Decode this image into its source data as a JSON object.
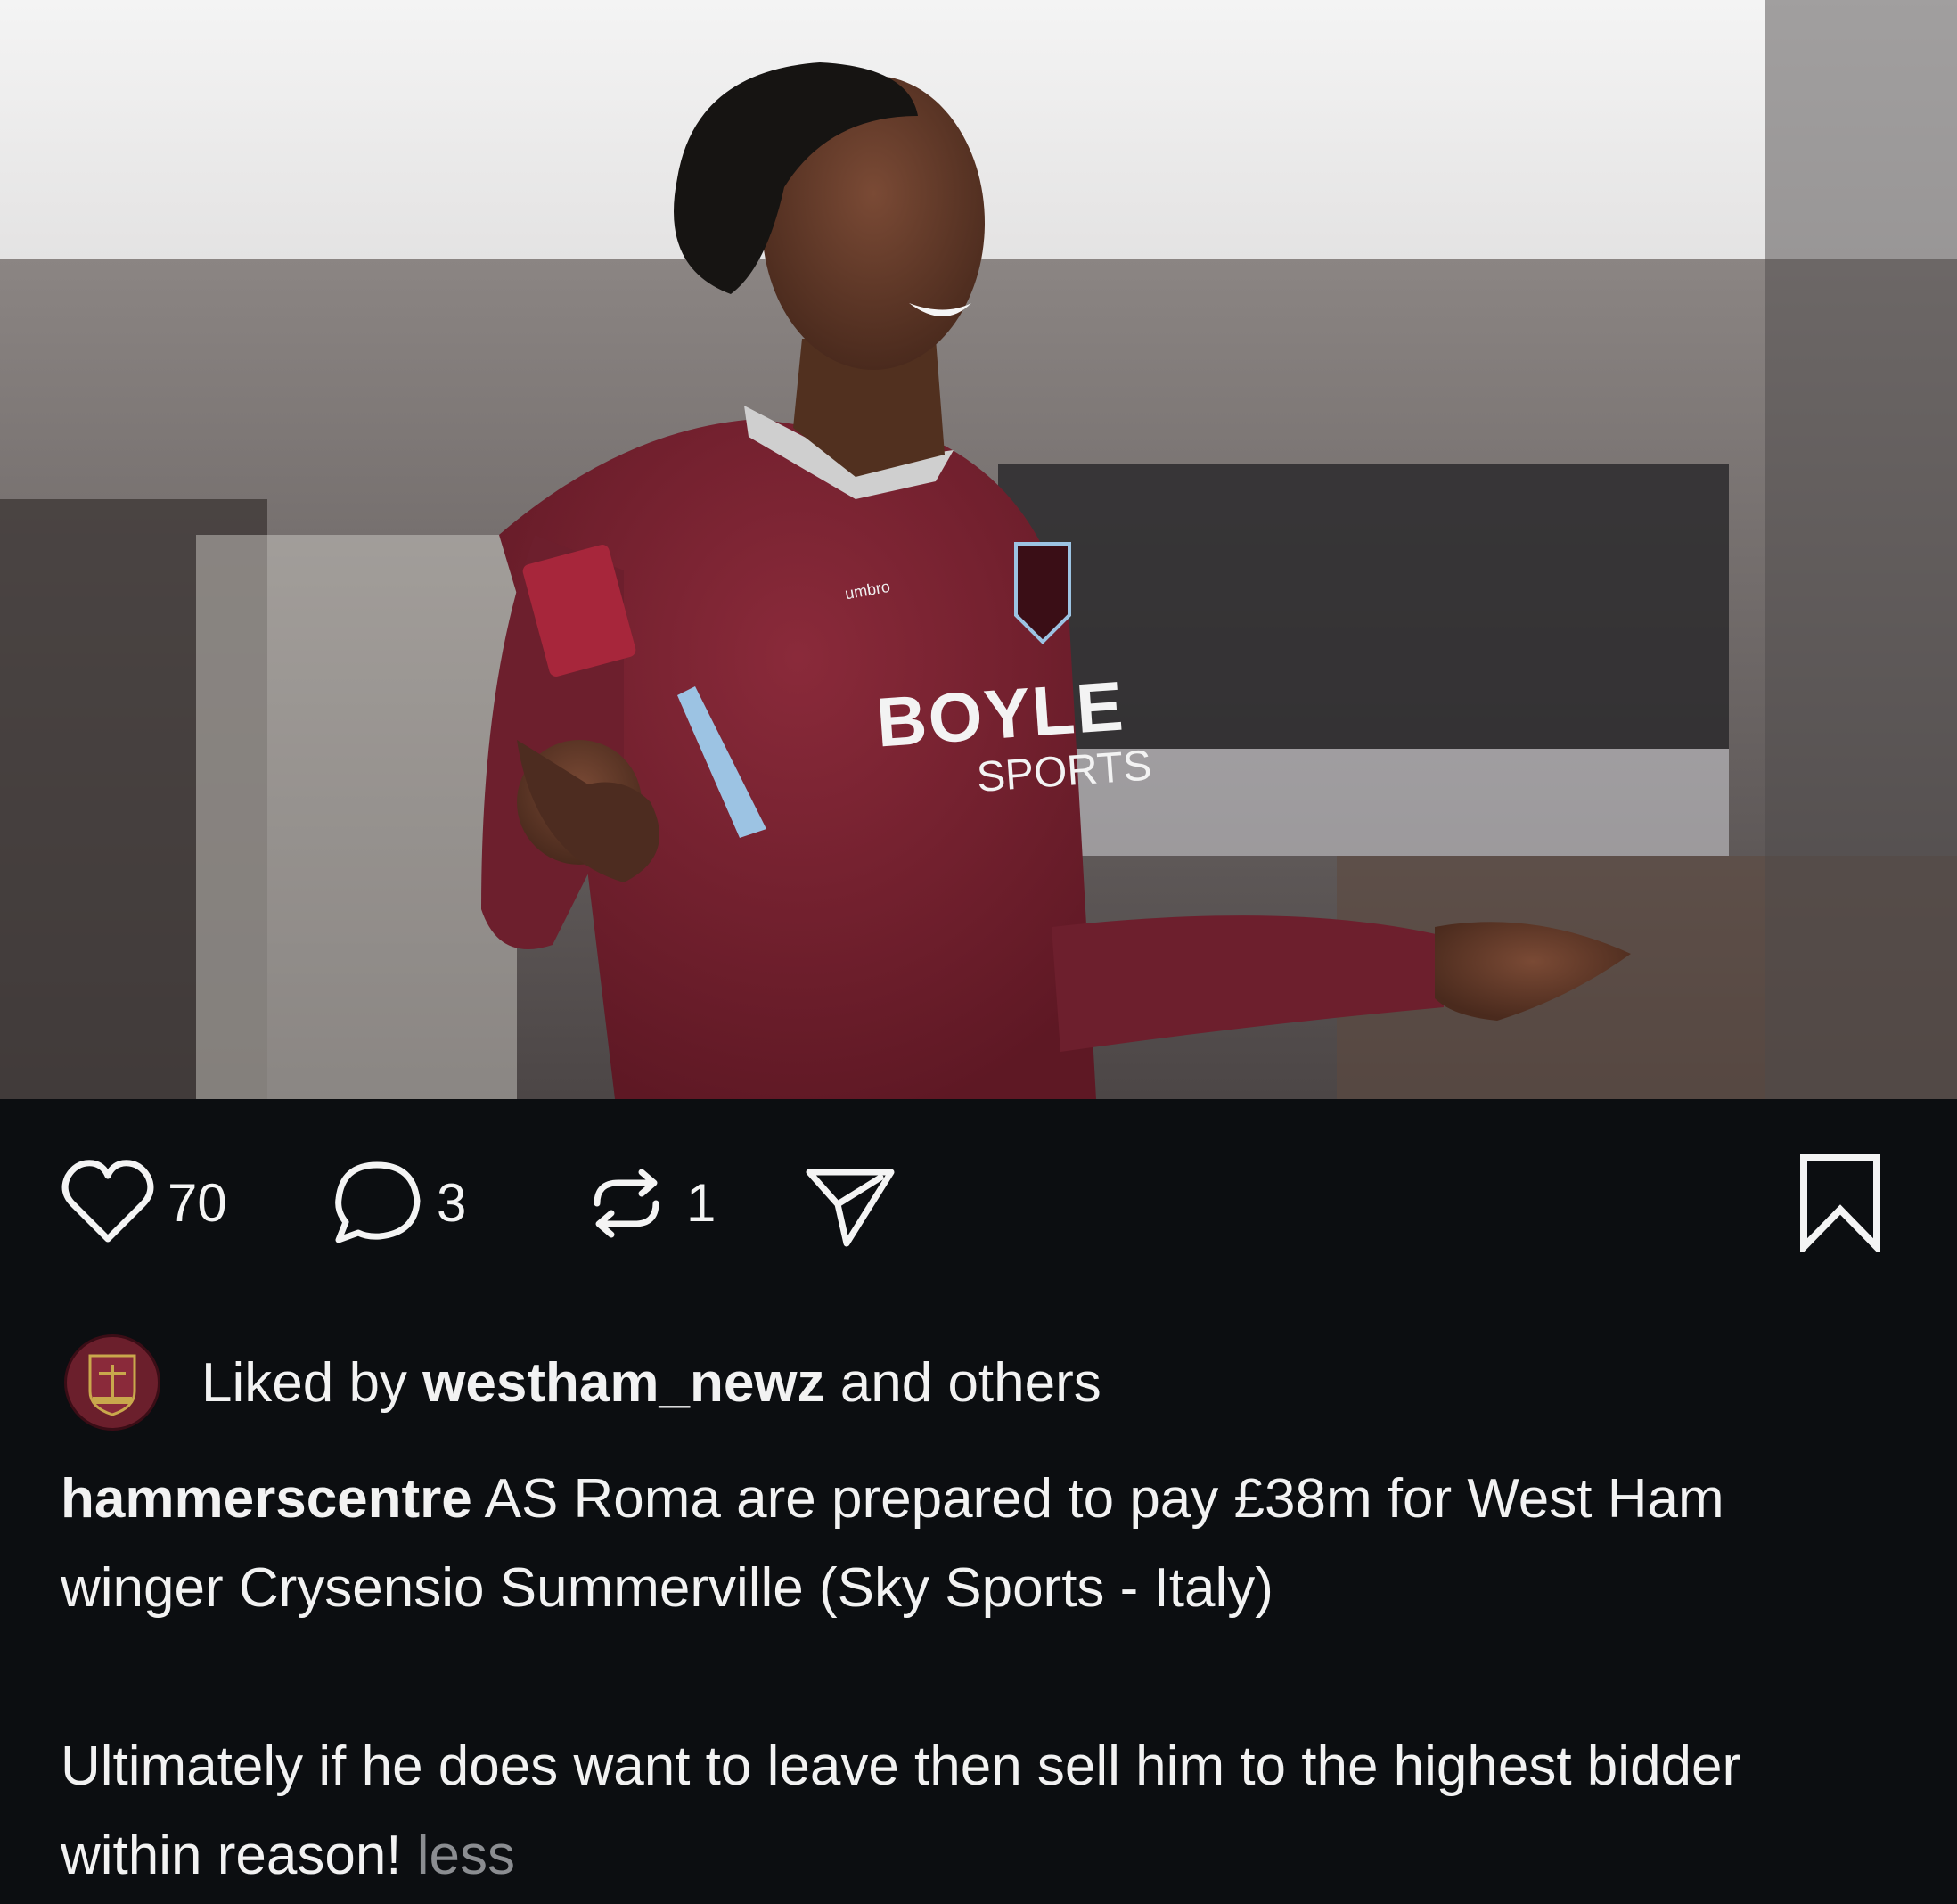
{
  "post": {
    "image_alt": "West Ham player in claret shirt celebrating with arms outstretched",
    "shirt_sponsor_line1": "BOYLE",
    "shirt_sponsor_line2": "SPORTS",
    "shirt_brand": "umbro"
  },
  "actions": {
    "likes_count": "70",
    "comments_count": "3",
    "reposts_count": "1",
    "icons": [
      "heart-icon",
      "comment-icon",
      "repost-icon",
      "share-icon",
      "bookmark-icon"
    ]
  },
  "liked_by": {
    "prefix": "Liked by ",
    "user": "westham_newz",
    "suffix": " and others"
  },
  "caption": {
    "username": "hammerscentre",
    "text_line": " AS Roma are prepared to pay £38m for West Ham winger Crysensio Summerville (Sky Sports - Italy)",
    "paragraph2": "Ultimately if he does want to leave then sell him to the highest bidder within reason!",
    "less_label": "less"
  },
  "colors": {
    "background": "#0c0e11",
    "shirt": "#7a2331",
    "muted": "#8b8d91"
  }
}
